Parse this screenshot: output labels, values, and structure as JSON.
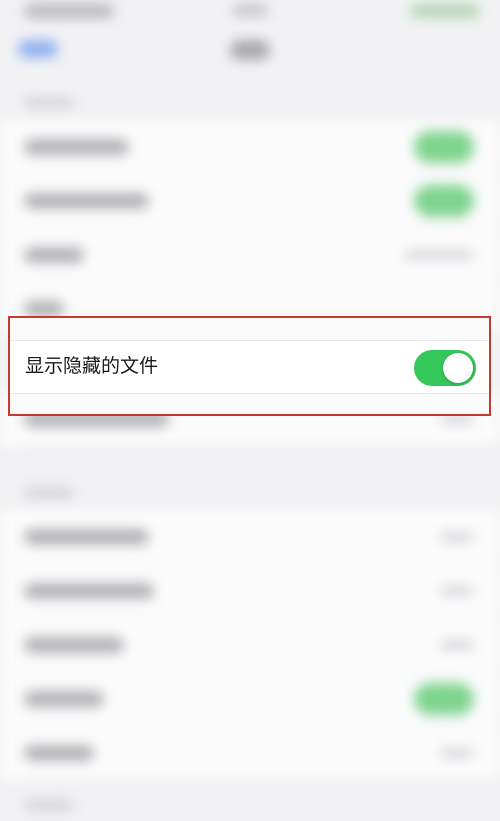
{
  "colors": {
    "accent_green": "#34c759",
    "highlight_border": "#c6392f",
    "background": "#f2f2f4"
  },
  "focused_setting": {
    "label": "显示隐藏的文件",
    "toggle_on": true
  }
}
